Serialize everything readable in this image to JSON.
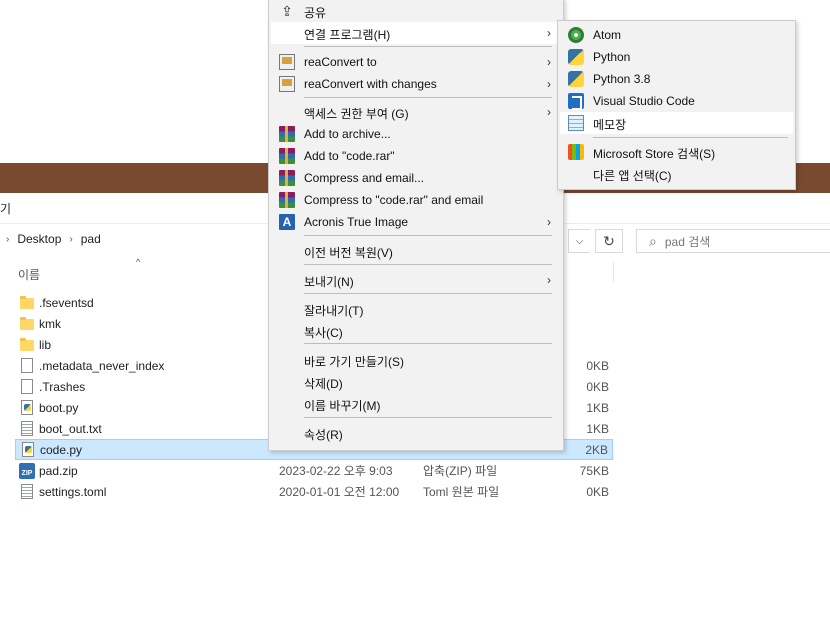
{
  "explorer": {
    "command_label": "기",
    "breadcrumb": [
      "Desktop",
      "pad"
    ],
    "search_placeholder": "pad 검색",
    "column_name": "이름",
    "files": [
      {
        "name": ".fseventsd",
        "icon": "folder-icon",
        "date": "",
        "type": "",
        "size": ""
      },
      {
        "name": "kmk",
        "icon": "folder-icon",
        "date": "",
        "type": "",
        "size": ""
      },
      {
        "name": "lib",
        "icon": "folder-icon",
        "date": "",
        "type": "",
        "size": ""
      },
      {
        "name": ".metadata_never_index",
        "icon": "file-icon",
        "date": "",
        "type": "",
        "size": "0KB"
      },
      {
        "name": ".Trashes",
        "icon": "file-icon",
        "date": "",
        "type": "",
        "size": "0KB"
      },
      {
        "name": "boot.py",
        "icon": "python-file-icon",
        "date": "",
        "type": "",
        "size": "1KB"
      },
      {
        "name": "boot_out.txt",
        "icon": "text-file-icon",
        "date": "",
        "type": "",
        "size": "1KB"
      },
      {
        "name": "code.py",
        "icon": "python-file-icon",
        "date": "",
        "type": "",
        "size": "2KB",
        "selected": true
      },
      {
        "name": "pad.zip",
        "icon": "zip-icon",
        "date": "2023-02-22 오후 9:03",
        "type": "압축(ZIP) 파일",
        "size": "75KB"
      },
      {
        "name": "settings.toml",
        "icon": "text-file-icon",
        "date": "2020-01-01 오전 12:00",
        "type": "Toml 원본 파일",
        "size": "0KB"
      }
    ]
  },
  "context_menu": {
    "items": [
      {
        "label": "공유",
        "icon": "share-icon"
      },
      {
        "label": "연결 프로그램(H)",
        "submenu": true,
        "highlighted": true
      },
      {
        "label": "reaConvert to",
        "icon": "reaconvert-icon",
        "submenu": true
      },
      {
        "label": "reaConvert with changes",
        "icon": "reaconvert-icon",
        "submenu": true
      },
      {
        "label": "액세스 권한 부여 (G)",
        "submenu": true
      },
      {
        "label": "Add to archive...",
        "icon": "winrar-icon"
      },
      {
        "label": "Add to \"code.rar\"",
        "icon": "winrar-icon"
      },
      {
        "label": "Compress and email...",
        "icon": "winrar-icon"
      },
      {
        "label": "Compress to \"code.rar\" and email",
        "icon": "winrar-icon"
      },
      {
        "label": "Acronis True Image",
        "icon": "acronis-icon",
        "submenu": true
      },
      {
        "label": "이전 버전 복원(V)"
      },
      {
        "label": "보내기(N)",
        "submenu": true
      },
      {
        "label": "잘라내기(T)"
      },
      {
        "label": "복사(C)"
      },
      {
        "label": "바로 가기 만들기(S)"
      },
      {
        "label": "삭제(D)"
      },
      {
        "label": "이름 바꾸기(M)"
      },
      {
        "label": "속성(R)"
      }
    ]
  },
  "open_with_submenu": {
    "items": [
      {
        "label": "Atom",
        "icon": "atom-icon"
      },
      {
        "label": "Python",
        "icon": "python-icon"
      },
      {
        "label": "Python 3.8",
        "icon": "python-icon"
      },
      {
        "label": "Visual Studio Code",
        "icon": "vscode-icon"
      },
      {
        "label": "메모장",
        "icon": "notepad-icon",
        "highlighted": true
      },
      {
        "label": "Microsoft Store 검색(S)",
        "icon": "store-icon"
      },
      {
        "label": "다른 앱 선택(C)"
      }
    ]
  },
  "glyphs": {
    "submenu_arrow": "›",
    "chevron_right": "›",
    "dropdown": "⌵",
    "refresh": "↻",
    "search": "⌕",
    "sort_up": "^"
  }
}
